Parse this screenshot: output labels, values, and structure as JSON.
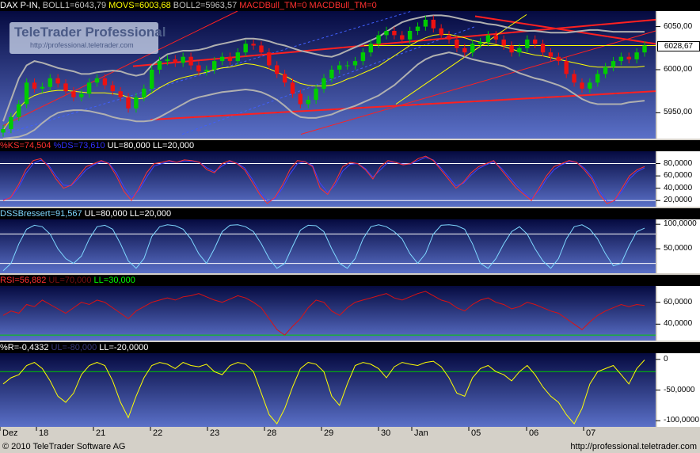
{
  "headers": {
    "price": {
      "parts": [
        {
          "text": "DAX P-IN,",
          "color": "#ffffff"
        },
        {
          "text": "BOLL1=6043,79",
          "color": "#c0c0c0"
        },
        {
          "text": "MOVS=6003,68",
          "color": "#ffff00"
        },
        {
          "text": "BOLL2=5963,57",
          "color": "#c0c0c0"
        },
        {
          "text": "MACDBull_TM=0",
          "color": "#ff3030"
        },
        {
          "text": "MACDBull_TM=0",
          "color": "#ff3030"
        }
      ]
    },
    "stoch": {
      "parts": [
        {
          "text": "%KS=74,504",
          "color": "#ff3030"
        },
        {
          "text": "%DS=73,610",
          "color": "#3030ff"
        },
        {
          "text": "UL=80,000",
          "color": "#ffffff"
        },
        {
          "text": "LL=20,000",
          "color": "#ffffff"
        }
      ]
    },
    "dss": {
      "parts": [
        {
          "text": "DSSBressert=91,567",
          "color": "#7fd8ff"
        },
        {
          "text": "UL=80,000",
          "color": "#ffffff"
        },
        {
          "text": "LL=20,000",
          "color": "#ffffff"
        }
      ]
    },
    "rsi": {
      "parts": [
        {
          "text": "RSI=56,882",
          "color": "#ff3030"
        },
        {
          "text": "UL=70,000",
          "color": "#7a1010"
        },
        {
          "text": "LL=30,000",
          "color": "#00ff00"
        }
      ]
    },
    "willr": {
      "parts": [
        {
          "text": "%R=-0,4332",
          "color": "#ffffff"
        },
        {
          "text": "UL=-80,000",
          "color": "#3a3a80"
        },
        {
          "text": "LL=-20,0000",
          "color": "#ffffff"
        }
      ]
    }
  },
  "logo": {
    "name": "TeleTrader Professional",
    "url": "http://professional.teletrader.com"
  },
  "last_price_label": "6028,67",
  "footer": {
    "copyright": "© 2010 TeleTrader Software AG",
    "url": "http://professional.teletrader.com"
  },
  "x_labels": [
    "Dez",
    "18",
    "21",
    "22",
    "23",
    "28",
    "29",
    "30",
    "Jan",
    "05",
    "06",
    "07"
  ],
  "colors": {
    "bullish": "#00cc00",
    "bearish": "#ee1111",
    "boll": "#b0b0b0",
    "movs": "#ffff00",
    "stochK": "#ff3030",
    "stochD": "#4040ff",
    "dss": "#7fd8ff",
    "rsi": "#dd1111",
    "willr": "#ffff00",
    "trend_red": "#ff2020",
    "trend_blue": "#4060ff",
    "guide_white": "#ffffff",
    "guide_green": "#00cc00"
  },
  "chart_data": [
    {
      "type": "candlestick",
      "name": "DAX P-IN",
      "ylim": [
        5920,
        6068
      ],
      "y_ticks": [
        "6050,00",
        "6000,00",
        "5950,00"
      ],
      "y_tick_values": [
        6050,
        6000,
        5950
      ],
      "close": [
        5931,
        5945,
        5960,
        5985,
        5978,
        5980,
        5990,
        5984,
        5975,
        5968,
        5972,
        5985,
        5990,
        5982,
        5975,
        5968,
        5955,
        5968,
        5978,
        6000,
        6010,
        6012,
        6008,
        6015,
        6005,
        5998,
        6000,
        6010,
        6015,
        6010,
        6020,
        6030,
        6028,
        6020,
        6005,
        5995,
        5985,
        5972,
        5960,
        5965,
        5978,
        5990,
        6000,
        6005,
        6005,
        6010,
        6020,
        6030,
        6040,
        6045,
        6040,
        6035,
        6045,
        6050,
        6058,
        6048,
        6040,
        6035,
        6025,
        6020,
        6030,
        6032,
        6040,
        6035,
        6028,
        6020,
        6025,
        6035,
        6030,
        6020,
        6015,
        6010,
        5995,
        5985,
        5978,
        5985,
        5995,
        6003,
        6010,
        6015,
        6012,
        6020,
        6028
      ],
      "volatility": 8,
      "bollinger_upper": [
        5940,
        5965,
        5990,
        6005,
        6010,
        6008,
        6005,
        6002,
        6000,
        5998,
        5995,
        5995,
        5997,
        5998,
        5999,
        5998,
        5995,
        5993,
        5995,
        6005,
        6012,
        6018,
        6020,
        6022,
        6022,
        6023,
        6025,
        6028,
        6030,
        6032,
        6034,
        6036,
        6036,
        6035,
        6033,
        6030,
        6028,
        6025,
        6022,
        6020,
        6018,
        6016,
        6015,
        6018,
        6022,
        6026,
        6030,
        6034,
        6038,
        6044,
        6050,
        6055,
        6058,
        6060,
        6062,
        6063,
        6063,
        6062,
        6060,
        6058,
        6056,
        6055,
        6053,
        6052,
        6050,
        6048,
        6046,
        6045,
        6045,
        6044,
        6043,
        6043,
        6043,
        6044,
        6045,
        6046,
        6046,
        6045,
        6044,
        6044,
        6044,
        6044,
        6044
      ],
      "bollinger_lower": [
        5920,
        5921,
        5922,
        5925,
        5930,
        5938,
        5945,
        5950,
        5952,
        5953,
        5953,
        5952,
        5950,
        5948,
        5945,
        5943,
        5942,
        5940,
        5940,
        5941,
        5945,
        5950,
        5955,
        5960,
        5965,
        5968,
        5970,
        5972,
        5974,
        5975,
        5976,
        5977,
        5976,
        5974,
        5970,
        5965,
        5958,
        5950,
        5945,
        5944,
        5944,
        5946,
        5948,
        5952,
        5955,
        5958,
        5962,
        5966,
        5970,
        5976,
        5982,
        5990,
        5998,
        6006,
        6012,
        6016,
        6018,
        6020,
        6018,
        6015,
        6012,
        6010,
        6008,
        6006,
        6004,
        6000,
        5996,
        5993,
        5990,
        5988,
        5985,
        5982,
        5978,
        5972,
        5966,
        5962,
        5960,
        5960,
        5960,
        5960,
        5962,
        5963,
        5964
      ],
      "movs": [
        5930,
        5943,
        5955,
        5965,
        5970,
        5973,
        5975,
        5976,
        5976,
        5975,
        5974,
        5973,
        5973,
        5973,
        5972,
        5971,
        5968,
        5966,
        5967,
        5973,
        5979,
        5984,
        5988,
        5991,
        5993,
        5995,
        5997,
        6000,
        6002,
        6003,
        6005,
        6007,
        6006,
        6004,
        6001,
        5997,
        5993,
        5988,
        5984,
        5982,
        5981,
        5981,
        5982,
        5985,
        5989,
        5992,
        5996,
        6000,
        6004,
        6010,
        6016,
        6022,
        6028,
        6033,
        6037,
        6040,
        6041,
        6041,
        6039,
        6037,
        6034,
        6032,
        6031,
        6029,
        6027,
        6024,
        6021,
        6019,
        6017,
        6016,
        6014,
        6012,
        6010,
        6008,
        6006,
        6004,
        6003,
        6003,
        6003,
        6003,
        6003,
        6003,
        6004
      ]
    },
    {
      "type": "line",
      "name": "Slow Stochastic",
      "ylim": [
        10,
        100
      ],
      "y_ticks": [
        "80,0000",
        "60,0000",
        "40,0000",
        "20,0000"
      ],
      "y_tick_values": [
        80,
        60,
        40,
        20
      ],
      "guides": [
        80,
        20
      ],
      "series": [
        {
          "name": "%KS",
          "values": [
            20,
            25,
            45,
            70,
            85,
            88,
            75,
            55,
            40,
            45,
            60,
            75,
            80,
            85,
            80,
            60,
            35,
            20,
            40,
            65,
            80,
            82,
            85,
            82,
            86,
            85,
            82,
            70,
            65,
            80,
            85,
            80,
            70,
            50,
            30,
            15,
            25,
            45,
            70,
            85,
            83,
            75,
            40,
            30,
            50,
            75,
            82,
            80,
            70,
            55,
            75,
            85,
            82,
            78,
            80,
            88,
            92,
            85,
            70,
            55,
            40,
            50,
            65,
            75,
            80,
            85,
            70,
            55,
            40,
            30,
            20,
            40,
            60,
            75,
            80,
            85,
            82,
            70,
            55,
            30,
            15,
            20,
            40,
            60,
            70,
            75
          ]
        },
        {
          "name": "%DS",
          "values": [
            22,
            24,
            40,
            64,
            80,
            86,
            78,
            60,
            45,
            44,
            56,
            70,
            78,
            83,
            81,
            65,
            42,
            25,
            36,
            58,
            76,
            80,
            83,
            82,
            84,
            84,
            82,
            73,
            67,
            76,
            83,
            81,
            73,
            55,
            35,
            19,
            22,
            40,
            63,
            80,
            83,
            77,
            48,
            33,
            45,
            68,
            79,
            80,
            72,
            58,
            70,
            82,
            82,
            79,
            79,
            85,
            90,
            86,
            73,
            59,
            44,
            48,
            61,
            72,
            78,
            83,
            73,
            59,
            45,
            33,
            23,
            35,
            55,
            70,
            78,
            83,
            82,
            73,
            59,
            36,
            19,
            19,
            35,
            55,
            67,
            73
          ]
        }
      ]
    },
    {
      "type": "line",
      "name": "DSS Bressert",
      "ylim": [
        0,
        110
      ],
      "y_ticks": [
        "100,0000",
        "50,0000"
      ],
      "y_tick_values": [
        100,
        50
      ],
      "guides": [
        80,
        20
      ],
      "series": [
        {
          "name": "DSSBressert",
          "values": [
            5,
            20,
            60,
            90,
            98,
            95,
            80,
            50,
            30,
            20,
            35,
            70,
            95,
            98,
            90,
            60,
            25,
            10,
            30,
            75,
            95,
            99,
            97,
            90,
            70,
            40,
            20,
            50,
            85,
            98,
            99,
            95,
            85,
            60,
            30,
            10,
            20,
            55,
            88,
            98,
            97,
            85,
            50,
            20,
            10,
            30,
            70,
            95,
            99,
            95,
            85,
            70,
            40,
            20,
            40,
            80,
            98,
            99,
            97,
            90,
            60,
            20,
            10,
            30,
            60,
            85,
            95,
            80,
            50,
            25,
            10,
            30,
            70,
            95,
            99,
            90,
            70,
            40,
            15,
            20,
            55,
            85,
            92
          ]
        }
      ]
    },
    {
      "type": "line",
      "name": "RSI",
      "ylim": [
        25,
        75
      ],
      "y_ticks": [
        "60,0000",
        "40,0000"
      ],
      "y_tick_values": [
        60,
        40
      ],
      "guides": [
        30
      ],
      "series": [
        {
          "name": "RSI",
          "values": [
            48,
            52,
            50,
            58,
            56,
            62,
            58,
            54,
            50,
            55,
            60,
            58,
            62,
            60,
            55,
            50,
            45,
            52,
            56,
            60,
            62,
            64,
            62,
            65,
            66,
            68,
            65,
            62,
            60,
            63,
            66,
            64,
            60,
            55,
            45,
            35,
            30,
            38,
            45,
            55,
            62,
            60,
            52,
            48,
            55,
            60,
            62,
            64,
            66,
            68,
            64,
            62,
            65,
            68,
            70,
            66,
            62,
            60,
            55,
            52,
            58,
            62,
            64,
            60,
            58,
            54,
            56,
            60,
            58,
            55,
            52,
            50,
            45,
            40,
            35,
            42,
            48,
            52,
            55,
            58,
            56,
            58,
            57
          ]
        }
      ]
    },
    {
      "type": "line",
      "name": "Williams %R",
      "ylim": [
        -110,
        10
      ],
      "y_ticks": [
        "0",
        "-50,0000",
        "-100,0000"
      ],
      "y_tick_values": [
        0,
        -50,
        -100
      ],
      "guides": [
        -20
      ],
      "series": [
        {
          "name": "%R",
          "values": [
            -40,
            -30,
            -25,
            -10,
            -5,
            -15,
            -35,
            -60,
            -70,
            -55,
            -25,
            -10,
            -5,
            -10,
            -35,
            -70,
            -95,
            -60,
            -30,
            -10,
            -5,
            -8,
            -15,
            -5,
            -10,
            -12,
            -8,
            -20,
            -25,
            -10,
            -5,
            -8,
            -20,
            -55,
            -90,
            -105,
            -80,
            -45,
            -15,
            -5,
            -8,
            -20,
            -60,
            -75,
            -40,
            -10,
            -5,
            -8,
            -15,
            -30,
            -12,
            -5,
            -8,
            -10,
            -5,
            -3,
            -12,
            -30,
            -55,
            -60,
            -30,
            -15,
            -10,
            -20,
            -25,
            -35,
            -20,
            -10,
            -25,
            -45,
            -60,
            -70,
            -90,
            -105,
            -80,
            -40,
            -20,
            -15,
            -10,
            -25,
            -40,
            -15,
            -1
          ]
        }
      ]
    }
  ]
}
